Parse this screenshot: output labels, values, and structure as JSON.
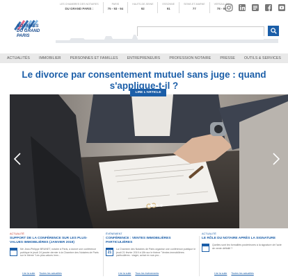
{
  "chambers": [
    {
      "line1": "Les chambres des Notaires",
      "line2": "DU GRAND PARIS :"
    },
    {
      "line1": "PARIS",
      "line2": "75 - 93 - 94"
    },
    {
      "line1": "HAUTS-DE-SEINE",
      "line2": "92"
    },
    {
      "line1": "ESSONNE",
      "line2": "91"
    },
    {
      "line1": "SEINE-ET-MARNE",
      "line2": "77"
    },
    {
      "line1": "VERSAILLES",
      "line2": "78 - 95"
    }
  ],
  "socials": [
    "instagram-icon",
    "linkedin-icon",
    "blog-icon",
    "facebook-icon",
    "youtube-icon"
  ],
  "logo": {
    "lines": [
      "NOTAIRES",
      "DU GRAND",
      "PARIS"
    ]
  },
  "search": {
    "placeholder": "",
    "value": ""
  },
  "nav": [
    "ACTUALITÉS",
    "IMMOBILIER",
    "PERSONNES ET FAMILLES",
    "ENTREPRENEURS",
    "PROFESSION NOTAIRE",
    "PRESSE",
    "OUTILS & SERVICES"
  ],
  "hero": {
    "headline": "Le divorce par consentement mutuel sans juge : quand s'applique-t-il ?",
    "cta": "LIRE L'ARTICLE"
  },
  "news": [
    {
      "category": "ACTUALITÉ",
      "title": "SUPPORT DE LA CONFÉRENCE SUR LES PLUS-VALUES IMMOBILIÈRES (JANVIER 2019)",
      "excerpt": "Me Jean-Philippe BRUNET, notaire à Paris, a donné une conférence publique le jeudi 24 janvier dernier à la Chambre des Notaires de Paris sur le thème \"Les plus-values imm...",
      "link1": "Lire la suite",
      "link2": "Toutes les actualités"
    },
    {
      "category": "ÉVÉNEMENT",
      "title": "CONFÉRENCE : VENTES IMMOBILIÈRES PARTICULIÈRES",
      "date": "21",
      "excerpt": "La Chambre des Notaires de Paris organise une conférence publique le jeudi 21 février 2019 à 18h sur le thème \"Ventes immobilières particulières : viager, achat en nue-pro...",
      "link1": "Lire la suite",
      "link2": "Tous les événements"
    },
    {
      "category": "ACTUALITÉ",
      "title": "LE RÔLE DU NOTAIRE APRÈS LA SIGNATURE",
      "excerpt": "Quelles sont les formalités postérieures à la signature de l'acte de vente définitif ?",
      "link1": "Lire la suite",
      "link2": "Toutes les actualités"
    }
  ],
  "colors": {
    "brand": "#1b5ea8",
    "accent": "#c0392b",
    "nav_bg": "#e9e9e9"
  }
}
